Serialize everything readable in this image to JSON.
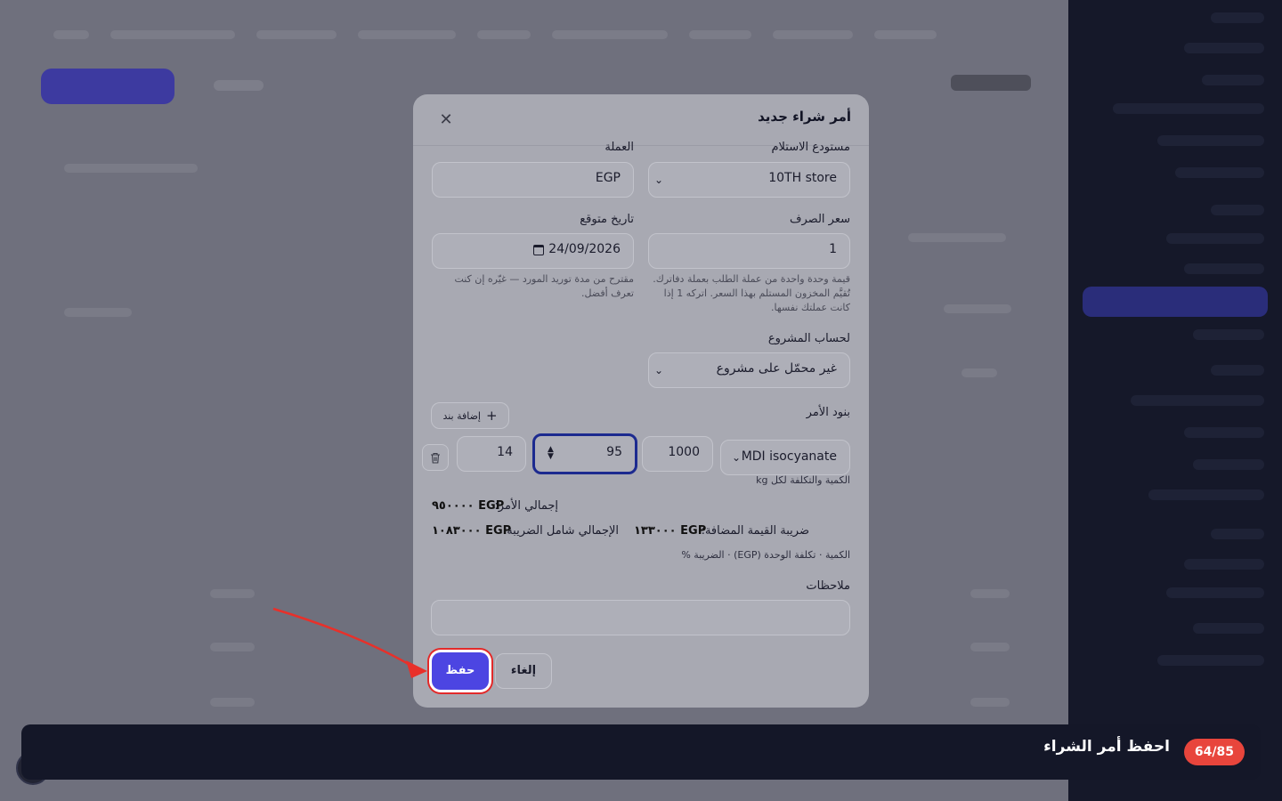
{
  "modal": {
    "title": "أمر شراء جديد",
    "close_icon": "close-icon",
    "warehouse_label": "مستودع الاستلام",
    "warehouse_value": "10TH store",
    "currency_label": "العملة",
    "currency_value": "EGP",
    "exchange_rate_label": "سعر الصرف",
    "exchange_rate_value": "1",
    "exchange_rate_hint": "قيمة وحدة واحدة من عملة الطلب بعملة دفاترك. تُقيَّم المخزون المستلم بهذا السعر. اتركه 1 إذا كانت عملتك نفسها.",
    "expected_date_label": "تاريخ متوقع",
    "expected_date_value": "24/09/2026",
    "expected_date_hint": "مقترح من مدة توريد المورد — غيّره إن كنت تعرف أفضل.",
    "project_label": "لحساب المشروع",
    "project_value": "غير محمّل على مشروع",
    "lines_label": "بنود الأمر",
    "add_line_label": "إضافة بند",
    "line": {
      "item": "MDI isocyanate",
      "quantity": "1000",
      "unit_cost": "95",
      "tax_percent": "14"
    },
    "line_caption": "الكمية والتكلفة لكل kg",
    "order_total_label": "إجمالي الأمر:",
    "order_total_value": "EGP ٩٥٠٠٠٠",
    "vat_label": "ضريبة القيمة المضافة:",
    "vat_value": "EGP ١٣٣٠٠٠",
    "grand_total_label": "الإجمالي شامل الضريبة:",
    "grand_total_value": "EGP ١٠٨٣٠٠٠",
    "columns_caption": "الكمية · تكلفة الوحدة (EGP) · الضريبة %",
    "notes_label": "ملاحظات",
    "notes_value": "",
    "cancel_label": "إلغاء",
    "save_label": "حفظ"
  },
  "banner": {
    "title": "احفظ أمر الشراء",
    "step": "64/85"
  },
  "colors": {
    "accent": "#4c45e2",
    "highlight": "#e22a2a",
    "badge": "#e8453c"
  }
}
